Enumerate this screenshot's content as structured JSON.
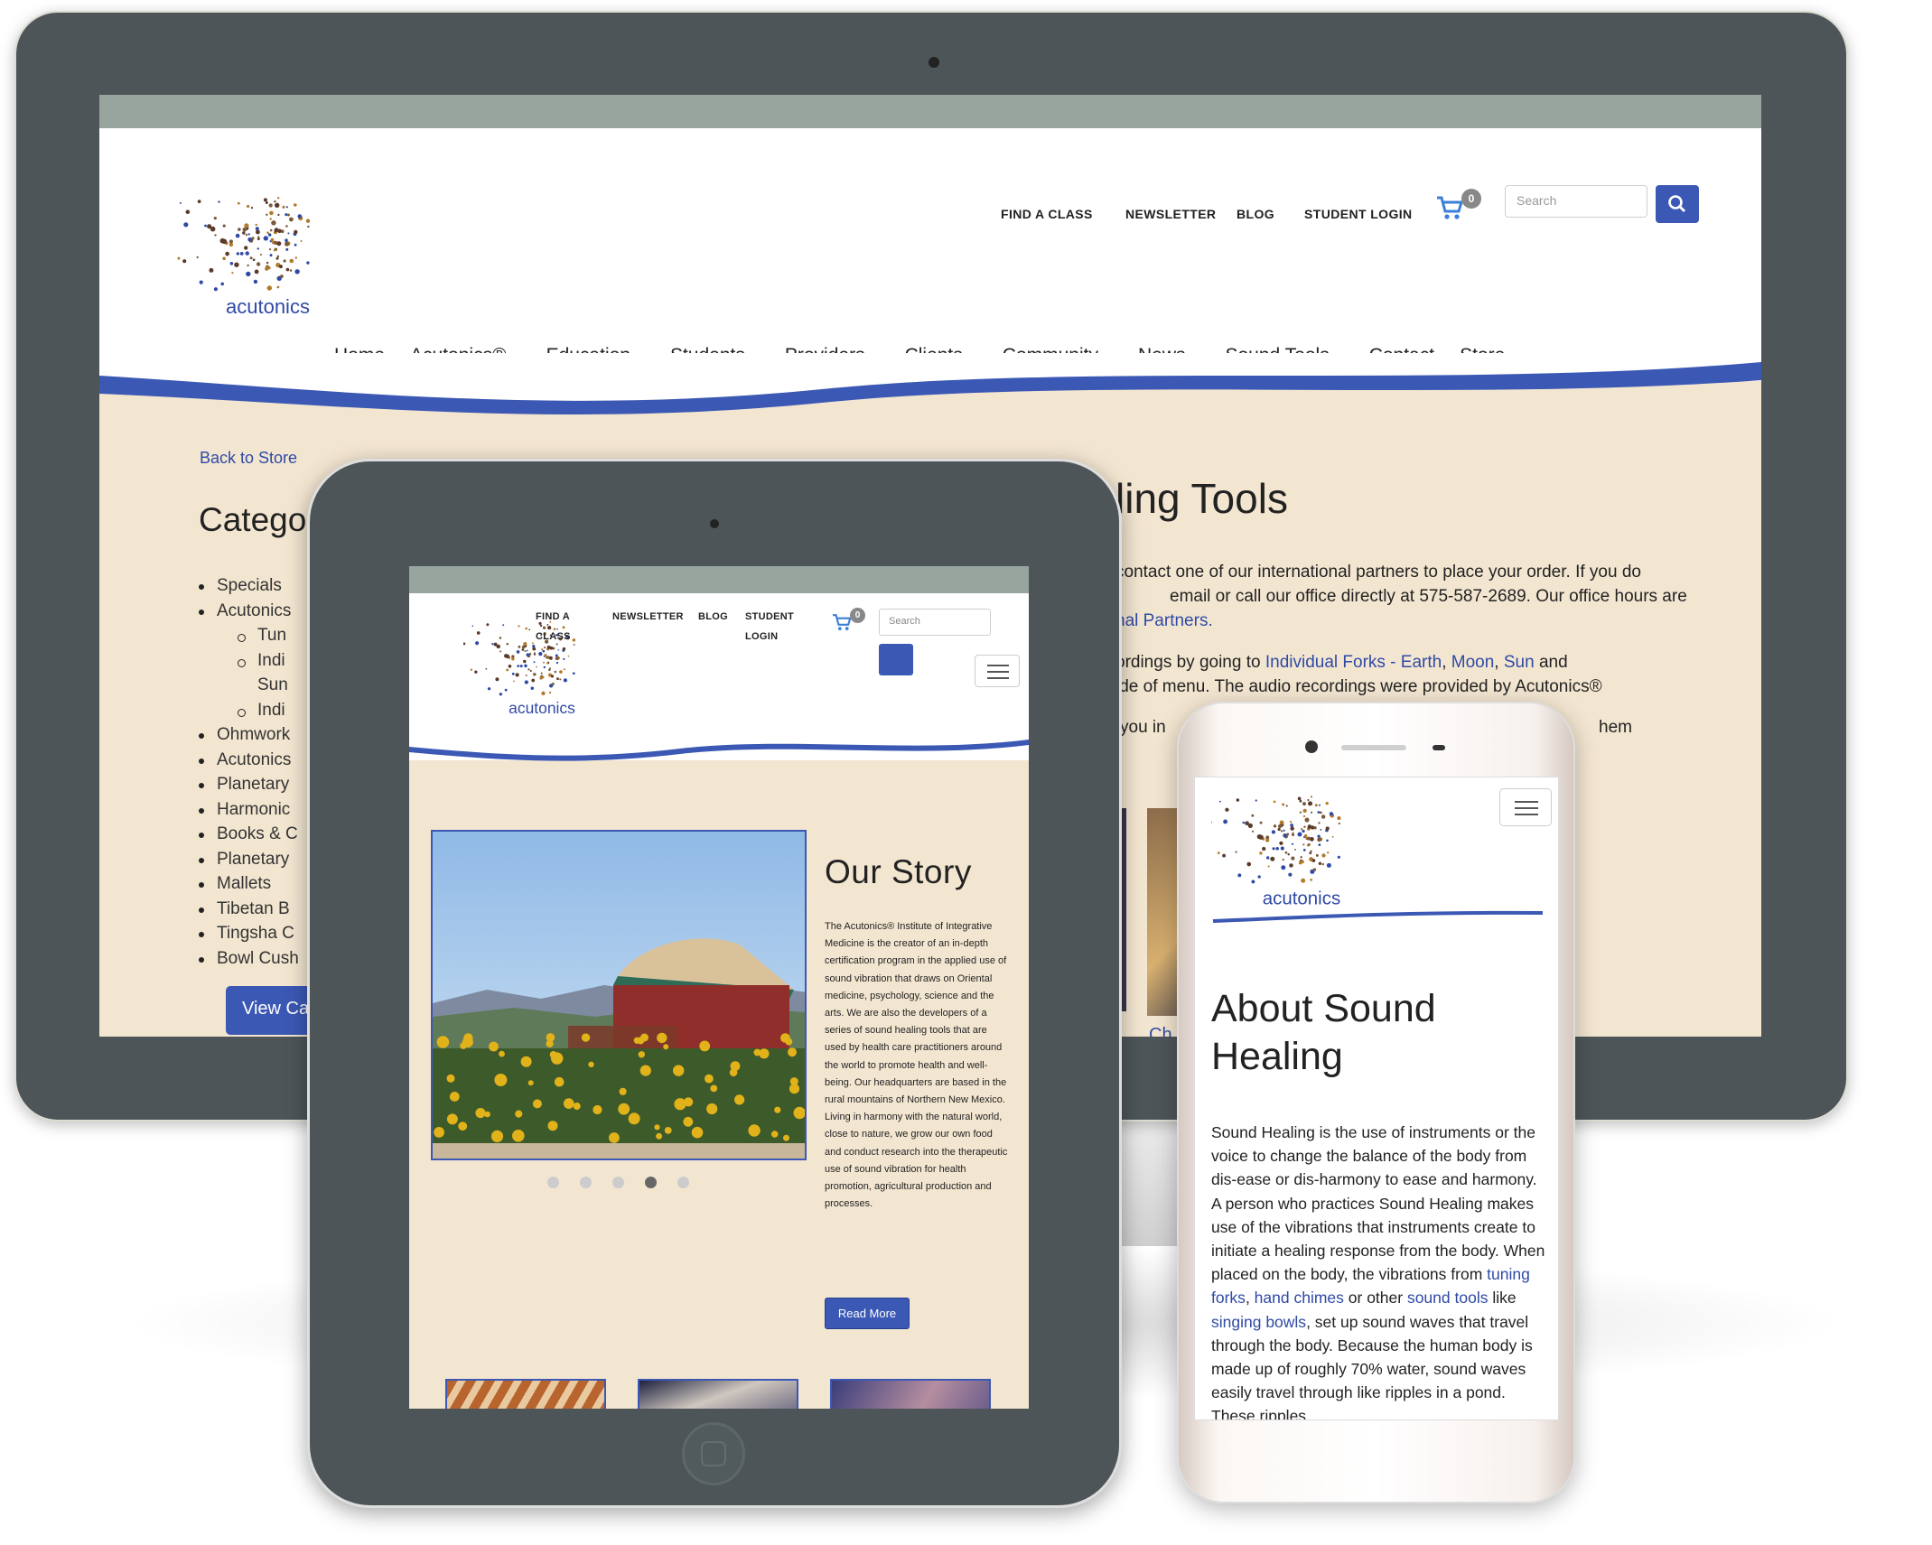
{
  "desktop": {
    "utility_nav": [
      "FIND A CLASS",
      "NEWSLETTER",
      "BLOG",
      "STUDENT LOGIN"
    ],
    "cart_count": "0",
    "search_placeholder": "Search",
    "main_nav": [
      {
        "label": "Home",
        "dropdown": false
      },
      {
        "label": "Acutonics®",
        "dropdown": true
      },
      {
        "label": "Education",
        "dropdown": true
      },
      {
        "label": "Students",
        "dropdown": true
      },
      {
        "label": "Providers",
        "dropdown": true
      },
      {
        "label": "Clients",
        "dropdown": true
      },
      {
        "label": "Community",
        "dropdown": true
      },
      {
        "label": "News",
        "dropdown": true
      },
      {
        "label": "Sound Tools",
        "dropdown": true
      },
      {
        "label": "Contact",
        "dropdown": false
      },
      {
        "label": "Store",
        "dropdown": false
      }
    ],
    "back_link": "Back to Store",
    "categories_heading": "Catego",
    "categories": [
      {
        "label": "Specials",
        "level": 1
      },
      {
        "label": "Acutonics",
        "level": 1
      },
      {
        "label": "Tun",
        "level": 2
      },
      {
        "label": "Indi",
        "level": 2
      },
      {
        "label": "Sun",
        "level": 3
      },
      {
        "label": "Indi",
        "level": 2
      },
      {
        "label": "Ohmwork",
        "level": 1
      },
      {
        "label": "Acutonics",
        "level": 1
      },
      {
        "label": "Planetary",
        "level": 1
      },
      {
        "label": "Harmonic",
        "level": 1
      },
      {
        "label": "Books & C",
        "level": 1
      },
      {
        "label": "Planetary",
        "level": 1
      },
      {
        "label": "Mallets",
        "level": 1
      },
      {
        "label": "Tibetan B",
        "level": 1
      },
      {
        "label": "Tingsha C",
        "level": 1
      },
      {
        "label": "Bowl Cush",
        "level": 1
      }
    ],
    "view_cart": "View Car",
    "page_heading": "ling Tools",
    "para1_line1": "contact one of our international partners to place your order. If you do",
    "para1_line2": "email or call our office directly at 575-587-2689. Our office hours are",
    "para1_link": "nal Partners.",
    "para2_pre": "ordings by going to ",
    "para2_links": [
      "Individual Forks - Earth",
      "Moon",
      "Sun"
    ],
    "para2_post": " and",
    "para2_line2": "ide of menu. The audio recordings were provided by Acutonics®",
    "para3_left": "you in",
    "para3_right": "hem",
    "partial_link": "Ch"
  },
  "tablet": {
    "utility_nav": [
      "FIND A CLASS",
      "NEWSLETTER",
      "BLOG",
      "STUDENT LOGIN"
    ],
    "cart_count": "0",
    "search_placeholder": "Search",
    "heading": "Our Story",
    "story": "The Acutonics® Institute of Integrative Medicine is the creator of an in-depth certification program in the applied use of sound vibration that draws on Oriental medicine, psychology, science and the arts. We are also the developers of a series of sound healing tools that are used by health care practitioners around the world to promote health and well-being. Our headquarters are based in the rural mountains of Northern New Mexico. Living in harmony with the natural world, close to nature, we grow our own food and conduct research into the therapeutic use of sound vibration for health promotion, agricultural production and processes.",
    "read_more": "Read More",
    "carousel_active": 4,
    "carousel_count": 5
  },
  "phone": {
    "heading_line1": "About Sound",
    "heading_line2": "Healing",
    "body_1": "Sound Healing is the use of instruments or the voice to change the balance of the body from dis-ease or dis-harmony to ease and harmony. A person who practices Sound Healing makes use of the vibrations that instruments create to initiate a healing response from the body. When placed on the body, the vibrations from ",
    "link_tuning_forks": "tuning forks",
    "sep_1": ", ",
    "link_hand_chimes": "hand chimes",
    "body_2": " or other ",
    "link_sound_tools": "sound tools",
    "body_3": " like ",
    "link_singing_bowls": "singing bowls",
    "body_4": ", set up sound waves that travel through the body. Because the human body is made up of roughly 70% water, sound waves easily travel through like ripples in a pond. These ripples"
  },
  "brand": {
    "logo_text": "acutonics",
    "accent_color": "#3b58b4",
    "bar_color": "#98a59e",
    "bg_color": "#f3e6d1"
  }
}
